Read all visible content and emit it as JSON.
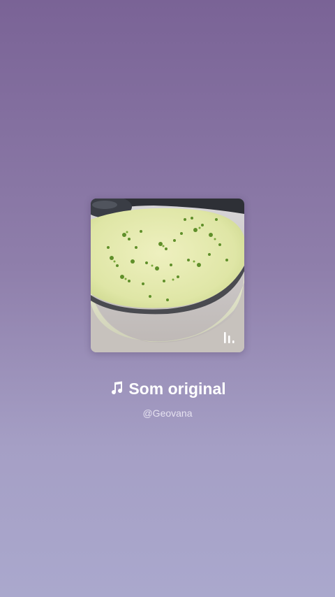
{
  "audio": {
    "title": "Som original",
    "artist": "@Geovana",
    "icon": "music-note-icon",
    "badge_icon": "audio-bars-icon"
  },
  "colors": {
    "background_top": "#7a6396",
    "background_bottom": "#aaa8cd",
    "text_primary": "#ffffff",
    "text_secondary": "#e6e2f0"
  }
}
